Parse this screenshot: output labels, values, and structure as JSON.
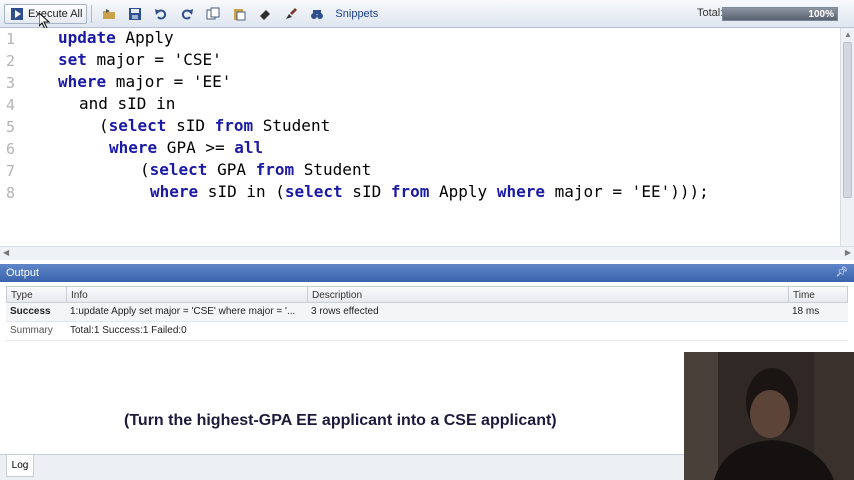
{
  "toolbar": {
    "execute_label": "Execute All",
    "snippets_label": "Snippets",
    "total_label": "Total:",
    "progress_text": "100%",
    "progress_fraction": 1.0
  },
  "editor": {
    "line_numbers": [
      "1",
      "2",
      "3",
      "4",
      "5",
      "6",
      "7",
      "8"
    ]
  },
  "output": {
    "title": "Output",
    "columns": [
      "Type",
      "Info",
      "Description",
      "Time"
    ],
    "rows": [
      {
        "type": "Success",
        "info": "1:update Apply set major = 'CSE' where major = '...",
        "description": "3 rows effected",
        "time": "18 ms"
      },
      {
        "type": "Summary",
        "info": "Total:1 Success:1 Failed:0",
        "description": "",
        "time": ""
      }
    ]
  },
  "caption": "(Turn the highest-GPA EE applicant into a CSE applicant)",
  "log_tab": "Log",
  "colors": {
    "keyword": "#1a1aa6",
    "titlebar": "#3b64ae",
    "caption": "#1e1a3c"
  }
}
